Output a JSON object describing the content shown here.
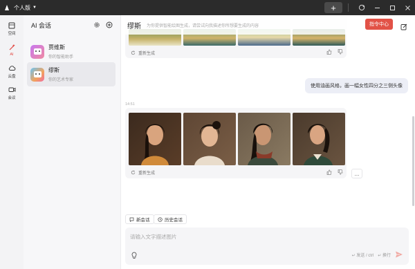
{
  "titlebar": {
    "brand": "个人版",
    "new_label": "+"
  },
  "rail": {
    "items": [
      {
        "label": "空间",
        "icon": "space-icon"
      },
      {
        "label": "AI",
        "icon": "ai-icon",
        "active": true
      },
      {
        "label": "云盘",
        "icon": "cloud-icon"
      },
      {
        "label": "会议",
        "icon": "meeting-icon"
      }
    ]
  },
  "panel": {
    "title": "AI 会话",
    "conversations": [
      {
        "name": "贾维斯",
        "sub": "你的智能助手"
      },
      {
        "name": "缪斯",
        "sub": "你的艺术专家"
      }
    ]
  },
  "chat": {
    "title": "缪斯",
    "desc": "为你提供智能绘图生成，请尝试向我描述你所想要生成的内容",
    "command_center": "指令中心",
    "regenerate": "重新生成",
    "user_message": "使用油画风格，画一幅女性四分之三侧头像",
    "timestamp": "14:51",
    "more": "..."
  },
  "toolbar": {
    "new_chat": "新会话",
    "history": "历史会话"
  },
  "input": {
    "placeholder": "请输入文字描述图片",
    "hint_send": "↵ 发送 / ctrl",
    "hint_newline": "↵ 换行"
  },
  "colors": {
    "accent": "#e25247",
    "titlebar": "#2b2b2b"
  }
}
